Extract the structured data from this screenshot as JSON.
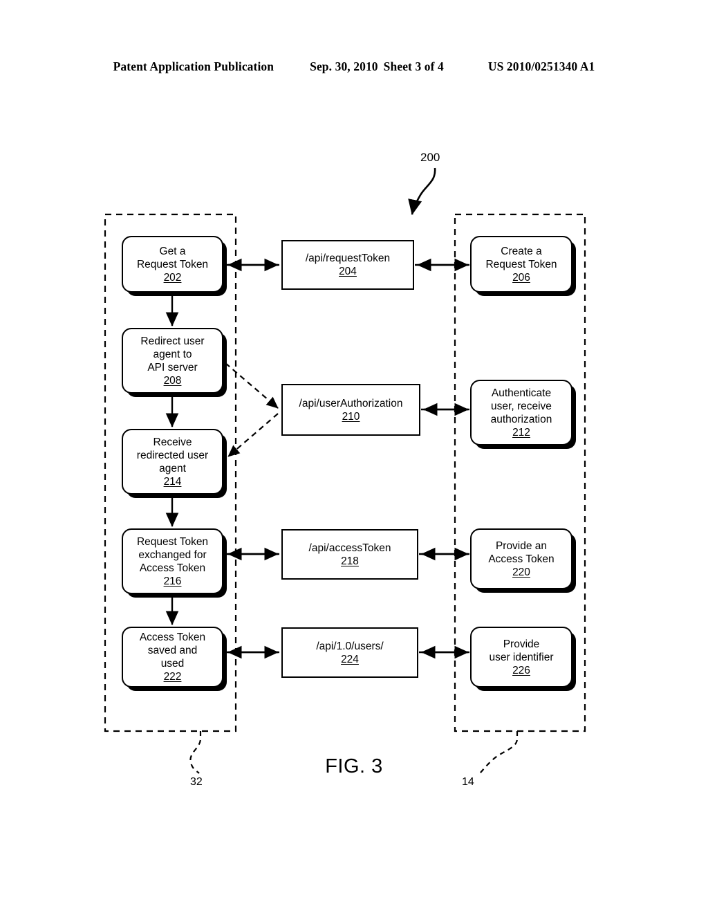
{
  "header": {
    "publication": "Patent Application Publication",
    "date": "Sep. 30, 2010",
    "sheet": "Sheet 3 of 4",
    "patent_number": "US 2010/0251340 A1"
  },
  "figure": {
    "caption": "FIG. 3",
    "diagram_ref": "200",
    "left_container_ref": "32",
    "right_container_ref": "14"
  },
  "nodes": {
    "n202": {
      "lines": [
        "Get a",
        "Request Token"
      ],
      "ref": "202"
    },
    "n204": {
      "lines": [
        "/api/requestToken"
      ],
      "ref": "204"
    },
    "n206": {
      "lines": [
        "Create a",
        "Request Token"
      ],
      "ref": "206"
    },
    "n208": {
      "lines": [
        "Redirect user",
        "agent to",
        "API server"
      ],
      "ref": "208"
    },
    "n210": {
      "lines": [
        "/api/userAuthorization"
      ],
      "ref": "210"
    },
    "n212": {
      "lines": [
        "Authenticate",
        "user, receive",
        "authorization"
      ],
      "ref": "212"
    },
    "n214": {
      "lines": [
        "Receive",
        "redirected user",
        "agent"
      ],
      "ref": "214"
    },
    "n216": {
      "lines": [
        "Request Token",
        "exchanged for",
        "Access Token"
      ],
      "ref": "216"
    },
    "n218": {
      "lines": [
        "/api/accessToken"
      ],
      "ref": "218"
    },
    "n220": {
      "lines": [
        "Provide an",
        "Access Token"
      ],
      "ref": "220"
    },
    "n222": {
      "lines": [
        "Access Token",
        "saved and",
        "used"
      ],
      "ref": "222"
    },
    "n224": {
      "lines": [
        "/api/1.0/users/"
      ],
      "ref": "224"
    },
    "n226": {
      "lines": [
        "Provide",
        "user identifier"
      ],
      "ref": "226"
    }
  }
}
